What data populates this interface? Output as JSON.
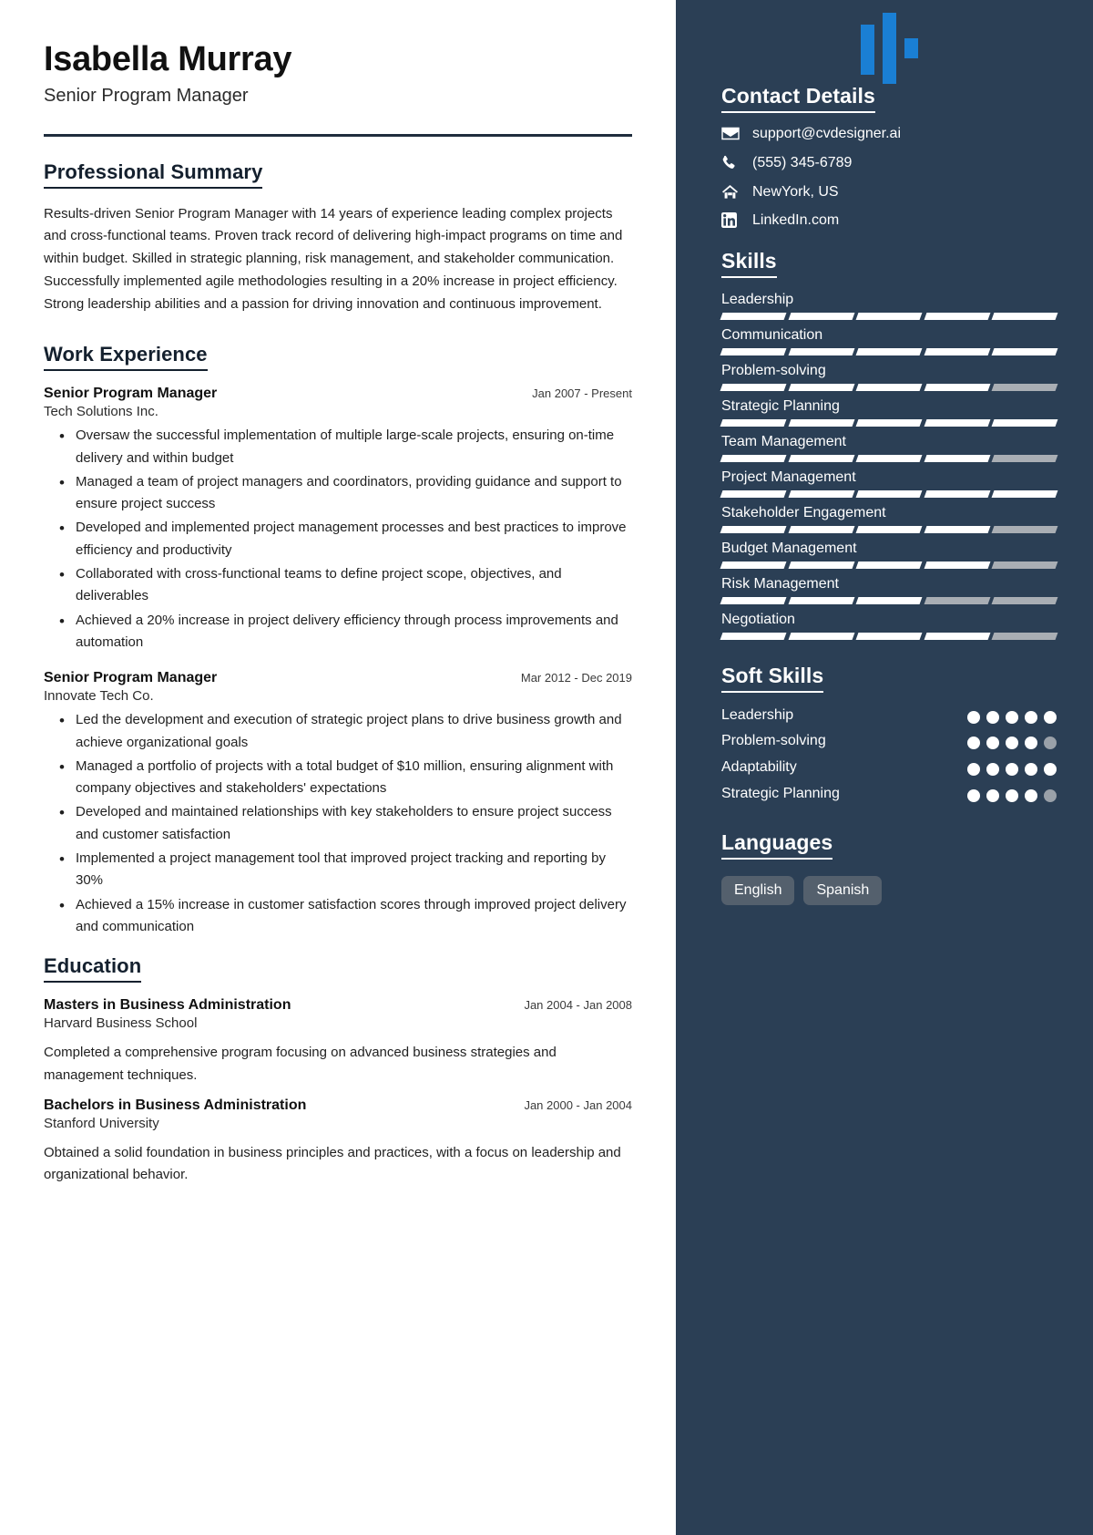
{
  "header": {
    "name": "Isabella Murray",
    "role": "Senior Program Manager"
  },
  "sections": {
    "summary_title": "Professional Summary",
    "summary_text": "Results-driven Senior Program Manager with 14 years of experience leading complex projects and cross-functional teams. Proven track record of delivering high-impact programs on time and within budget. Skilled in strategic planning, risk management, and stakeholder communication. Successfully implemented agile methodologies resulting in a 20% increase in project efficiency. Strong leadership abilities and a passion for driving innovation and continuous improvement.",
    "work_title": "Work Experience",
    "education_title": "Education"
  },
  "work": [
    {
      "title": "Senior Program Manager",
      "dates": "Jan 2007 - Present",
      "company": "Tech Solutions Inc.",
      "bullets": [
        "Oversaw the successful implementation of multiple large-scale projects, ensuring on-time delivery and within budget",
        "Managed a team of project managers and coordinators, providing guidance and support to ensure project success",
        "Developed and implemented project management processes and best practices to improve efficiency and productivity",
        "Collaborated with cross-functional teams to define project scope, objectives, and deliverables",
        "Achieved a 20% increase in project delivery efficiency through process improvements and automation"
      ]
    },
    {
      "title": "Senior Program Manager",
      "dates": "Mar 2012 - Dec 2019",
      "company": "Innovate Tech Co.",
      "bullets": [
        "Led the development and execution of strategic project plans to drive business growth and achieve organizational goals",
        "Managed a portfolio of projects with a total budget of $10 million, ensuring alignment with company objectives and stakeholders' expectations",
        "Developed and maintained relationships with key stakeholders to ensure project success and customer satisfaction",
        "Implemented a project management tool that improved project tracking and reporting by 30%",
        "Achieved a 15% increase in customer satisfaction scores through improved project delivery and communication"
      ]
    }
  ],
  "education": [
    {
      "degree": "Masters in Business Administration",
      "dates": "Jan 2004 - Jan 2008",
      "school": "Harvard Business School",
      "description": "Completed a comprehensive program focusing on advanced business strategies and management techniques."
    },
    {
      "degree": "Bachelors in Business Administration",
      "dates": "Jan 2000 - Jan 2004",
      "school": "Stanford University",
      "description": "Obtained a solid foundation in business principles and practices, with a focus on leadership and organizational behavior."
    }
  ],
  "sidebar": {
    "logo_icon": "three-bar-logo-icon",
    "contact_title": "Contact Details",
    "contact": [
      {
        "icon": "envelope-icon",
        "value": "support@cvdesigner.ai"
      },
      {
        "icon": "phone-icon",
        "value": "(555) 345-6789"
      },
      {
        "icon": "home-icon",
        "value": "NewYork, US"
      },
      {
        "icon": "linkedin-icon",
        "value": "LinkedIn.com"
      }
    ],
    "skills_title": "Skills",
    "skills": [
      {
        "name": "Leadership",
        "filled": 5,
        "total": 5
      },
      {
        "name": "Communication",
        "filled": 5,
        "total": 5
      },
      {
        "name": "Problem-solving",
        "filled": 4,
        "total": 5
      },
      {
        "name": "Strategic Planning",
        "filled": 5,
        "total": 5
      },
      {
        "name": "Team Management",
        "filled": 4,
        "total": 5
      },
      {
        "name": "Project Management",
        "filled": 5,
        "total": 5
      },
      {
        "name": "Stakeholder Engagement",
        "filled": 4,
        "total": 5
      },
      {
        "name": "Budget Management",
        "filled": 4,
        "total": 5
      },
      {
        "name": "Risk Management",
        "filled": 3,
        "total": 5
      },
      {
        "name": "Negotiation",
        "filled": 4,
        "total": 5
      }
    ],
    "soft_skills_title": "Soft Skills",
    "soft_skills": [
      {
        "name": "Leadership",
        "filled": 5,
        "total": 5
      },
      {
        "name": "Problem-solving",
        "filled": 4,
        "total": 5
      },
      {
        "name": "Adaptability",
        "filled": 5,
        "total": 5
      },
      {
        "name": "Strategic Planning",
        "filled": 4,
        "total": 5
      }
    ],
    "languages_title": "Languages",
    "languages": [
      "English",
      "Spanish"
    ]
  },
  "colors": {
    "sidebar_bg": "#2b3f55",
    "accent_blue": "#1a7fd4",
    "bar_on": "#ffffff",
    "bar_off": "#a9aeb4",
    "tag_bg": "#54606d"
  }
}
